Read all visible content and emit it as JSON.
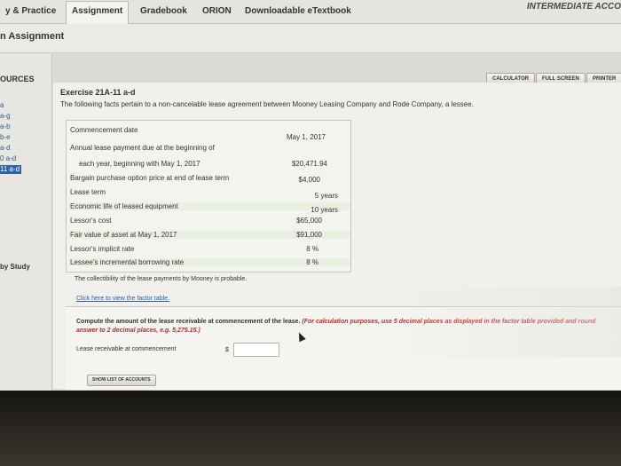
{
  "top_tabs": [
    {
      "label": "y & Practice"
    },
    {
      "label": "Assignment",
      "active": true
    },
    {
      "label": "Gradebook"
    },
    {
      "label": "ORION"
    },
    {
      "label": "Downloadable eTextbook"
    }
  ],
  "course_title": "INTERMEDIATE ACCO",
  "page_title": "n Assignment",
  "sidebar": {
    "title": "OURCES",
    "items": [
      {
        "label": "a"
      },
      {
        "label": "a-g"
      },
      {
        "label": "a-b"
      },
      {
        "label": "b-e"
      },
      {
        "label": "a-d"
      },
      {
        "label": "0 a-d"
      },
      {
        "label": "11 a-d",
        "selected": true
      }
    ],
    "study_label": "by Study"
  },
  "toolbar": {
    "calculator": "CALCULATOR",
    "full_screen": "FULL SCREEN",
    "printer": "PRINTER"
  },
  "exercise": {
    "title": "Exercise 21A-11 a-d",
    "intro": "The following facts pertain to a non-cancelable lease agreement between Mooney Leasing Company and Rode Company, a lessee.",
    "facts": [
      {
        "label": "Commencement date",
        "value": "May 1, 2017"
      },
      {
        "label": "Annual lease payment due at the beginning of",
        "value": ""
      },
      {
        "label": "each year, beginning with May 1, 2017",
        "value": "$20,471.94"
      },
      {
        "label": "Bargain purchase option price at end of lease term",
        "value": "$4,000"
      },
      {
        "label": "Lease term",
        "value": "5 years"
      },
      {
        "label": "Economic life of leased equipment",
        "value": "10 years"
      },
      {
        "label": "Lessor's cost",
        "value": "$65,000"
      },
      {
        "label": "Fair value of asset at May 1, 2017",
        "value": "$91,000"
      },
      {
        "label": "Lessor's implicit rate",
        "value": "8 %"
      },
      {
        "label": "Lessee's incremental borrowing rate",
        "value": "8 %"
      }
    ],
    "probable_text": "The collectibility of the lease payments by Mooney is probable.",
    "factor_link": "Click here to view the factor table."
  },
  "question": {
    "text": "Compute the amount of the lease receivable at commencement of the lease.",
    "hint": "(For calculation purposes, use 5 decimal places as displayed in the factor table provided and round answer to 2 decimal places, e.g. 5,275.15.)",
    "field_label": "Lease receivable at commencement",
    "currency": "$",
    "field_value": "",
    "show_list_button": "SHOW LIST OF ACCOUNTS"
  }
}
